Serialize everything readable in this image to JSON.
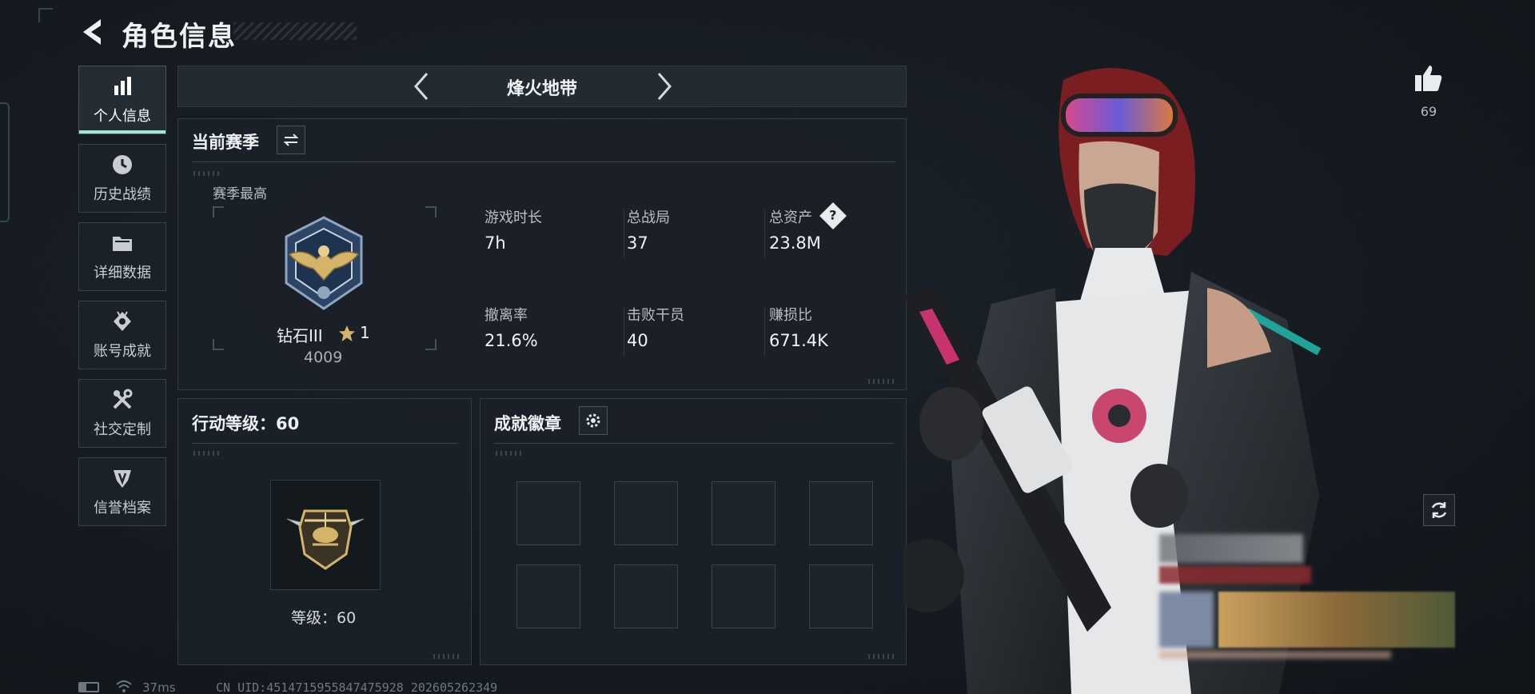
{
  "header": {
    "title": "角色信息"
  },
  "sidebar": {
    "items": [
      {
        "label": "个人信息",
        "icon": "bar-chart-icon",
        "active": true
      },
      {
        "label": "历史战绩",
        "icon": "clock-icon"
      },
      {
        "label": "详细数据",
        "icon": "folder-icon"
      },
      {
        "label": "账号成就",
        "icon": "achievement-icon"
      },
      {
        "label": "社交定制",
        "icon": "tools-icon"
      },
      {
        "label": "信誉档案",
        "icon": "shield-icon"
      }
    ]
  },
  "mode": {
    "name": "烽火地带"
  },
  "season": {
    "title": "当前赛季",
    "best_label": "赛季最高",
    "rank_name": "钻石III",
    "rank_stars": "1",
    "rank_points": "4009",
    "stats": [
      {
        "label": "游戏时长",
        "value": "7h"
      },
      {
        "label": "总战局",
        "value": "37"
      },
      {
        "label": "总资产",
        "value": "23.8M"
      },
      {
        "label": "撤离率",
        "value": "21.6%"
      },
      {
        "label": "击败干员",
        "value": "40"
      },
      {
        "label": "赚损比",
        "value": "671.4K"
      }
    ],
    "assets_help": "?"
  },
  "action_level": {
    "title": "行动等级：60",
    "level_text": "等级：60"
  },
  "badges": {
    "title": "成就徽章",
    "slots": 8
  },
  "profile": {
    "likes": "69"
  },
  "footer": {
    "ping": "37ms",
    "uid": "CN UID:4514715955847475928 202605262349"
  },
  "colors": {
    "accent": "#9ee5dc",
    "gold": "#d4b46a"
  }
}
